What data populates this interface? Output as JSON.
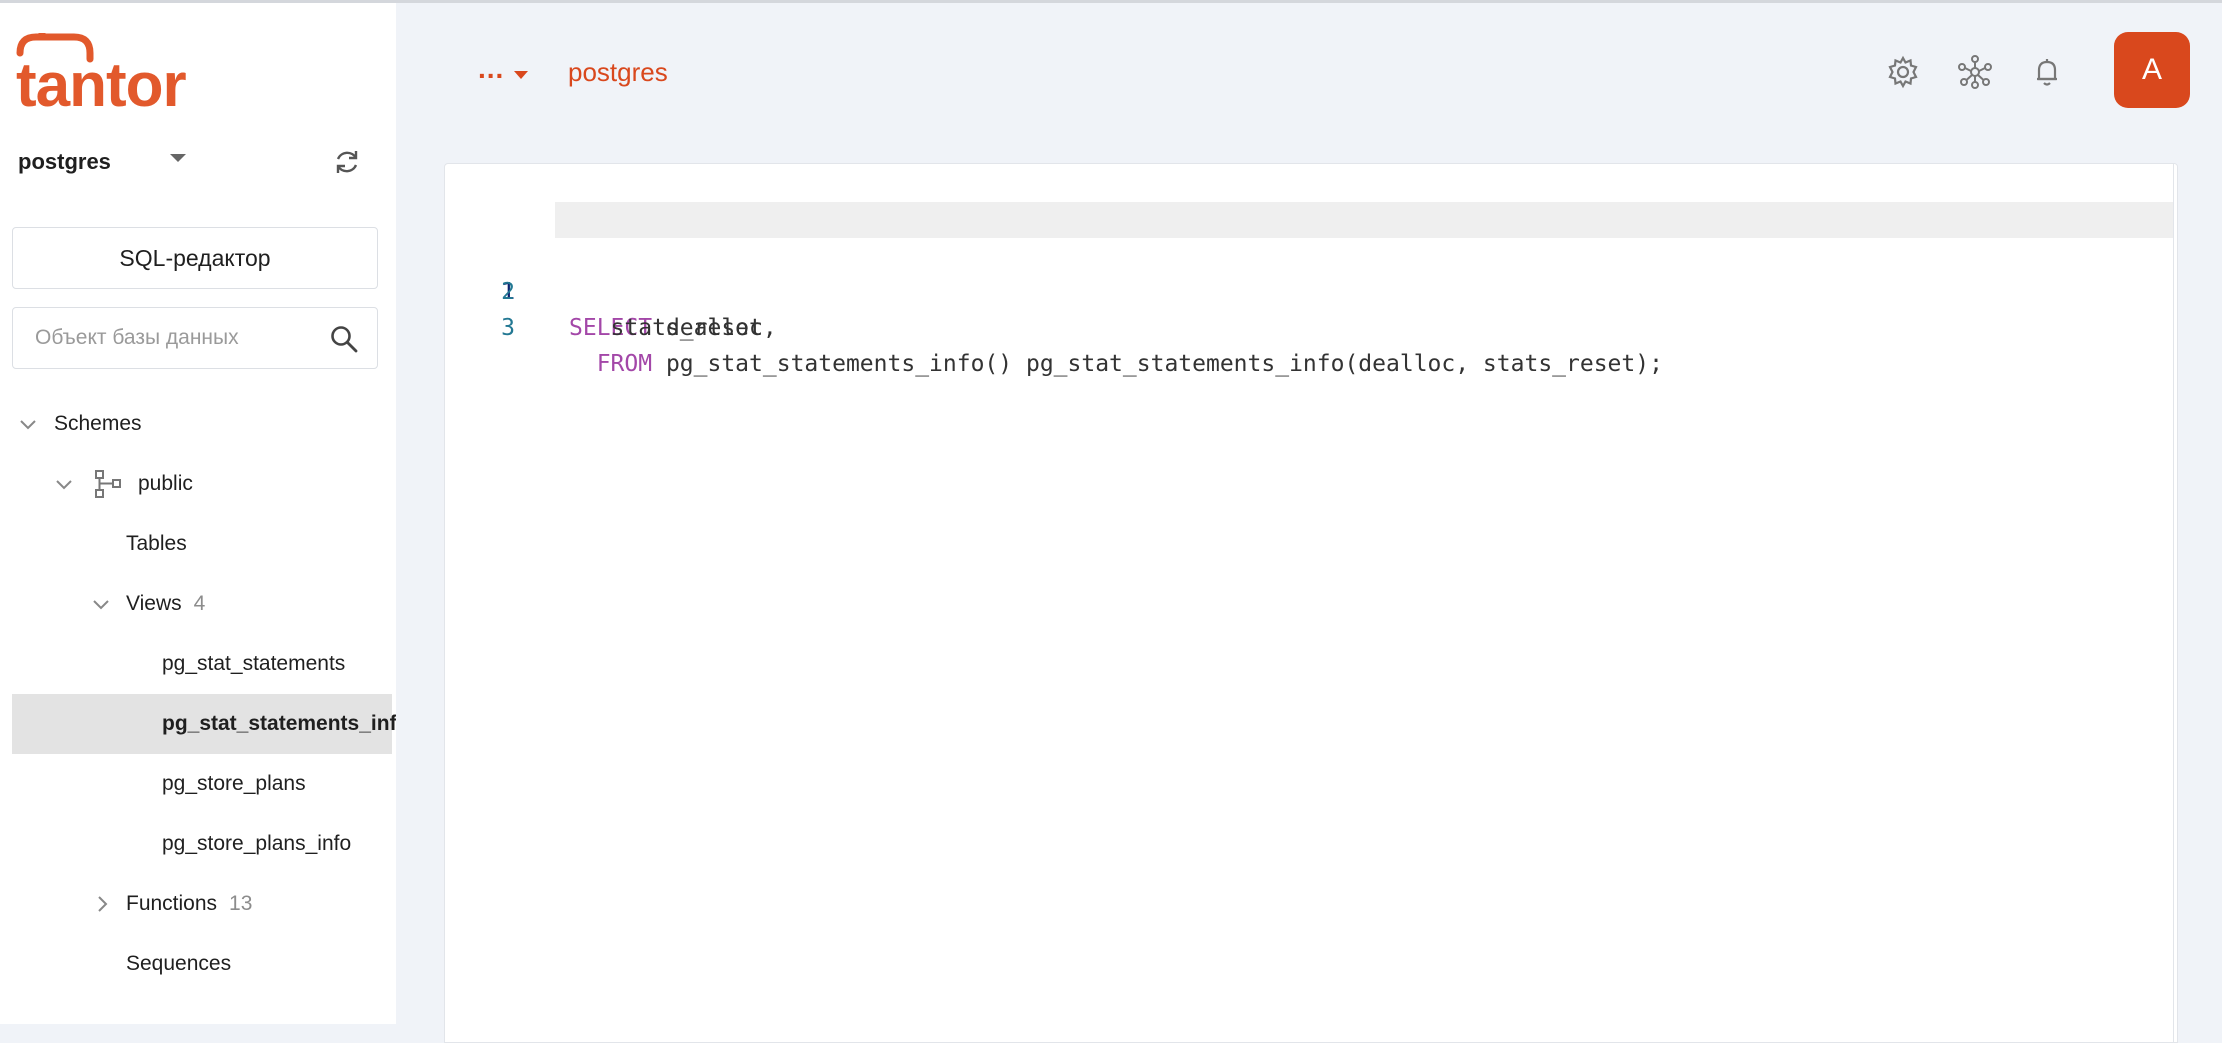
{
  "brand": {
    "logo_text": "tantor",
    "accent": "#E2592C"
  },
  "sidebar": {
    "database": "postgres",
    "sql_editor_label": "SQL-редактор",
    "search_placeholder": "Объект базы данных",
    "tree": {
      "schemes_label": "Schemes",
      "schema_name": "public",
      "tables_label": "Tables",
      "views_label": "Views",
      "views_count": "4",
      "views": [
        "pg_stat_statements",
        "pg_stat_statements_info",
        "pg_store_plans",
        "pg_store_plans_info"
      ],
      "selected_view": "pg_stat_statements_info",
      "functions_label": "Functions",
      "functions_count": "13",
      "sequences_label": "Sequences"
    }
  },
  "header": {
    "breadcrumb_more": "...",
    "breadcrumb_db": "postgres",
    "icons": [
      "settings-icon",
      "cluster-icon",
      "bell-icon"
    ],
    "avatar_initial": "A"
  },
  "editor": {
    "lines": [
      {
        "num": "1",
        "kw": "SELECT",
        "text": " dealloc,"
      },
      {
        "num": "2",
        "kw": "",
        "text": "   stats_reset"
      },
      {
        "num": "3",
        "kw": "  FROM",
        "text": " pg_stat_statements_info() pg_stat_statements_info(dealloc, stats_reset);"
      }
    ]
  }
}
